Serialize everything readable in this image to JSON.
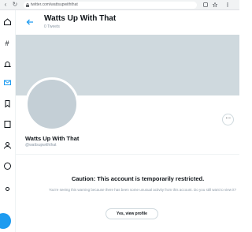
{
  "browser": {
    "back_glyph": "‹",
    "refresh_glyph": "↻",
    "url": "twitter.com/wattsupwiththat"
  },
  "header": {
    "title": "Watts Up With That",
    "subtitle": "0 Tweets"
  },
  "profile": {
    "name": "Watts Up With That",
    "handle": "@wattsupwiththat",
    "more_glyph": "···"
  },
  "restriction": {
    "title": "Caution: This account is temporarily restricted.",
    "message": "You're seeing this warning because there has been some unusual activity from this account. Do you still want to view it?",
    "button": "Yes, view profile"
  },
  "colors": {
    "accent": "#1d9bf0",
    "banner": "#cfd9de",
    "avatar": "#c4cfd6",
    "secondary_text": "#8b98a5"
  }
}
